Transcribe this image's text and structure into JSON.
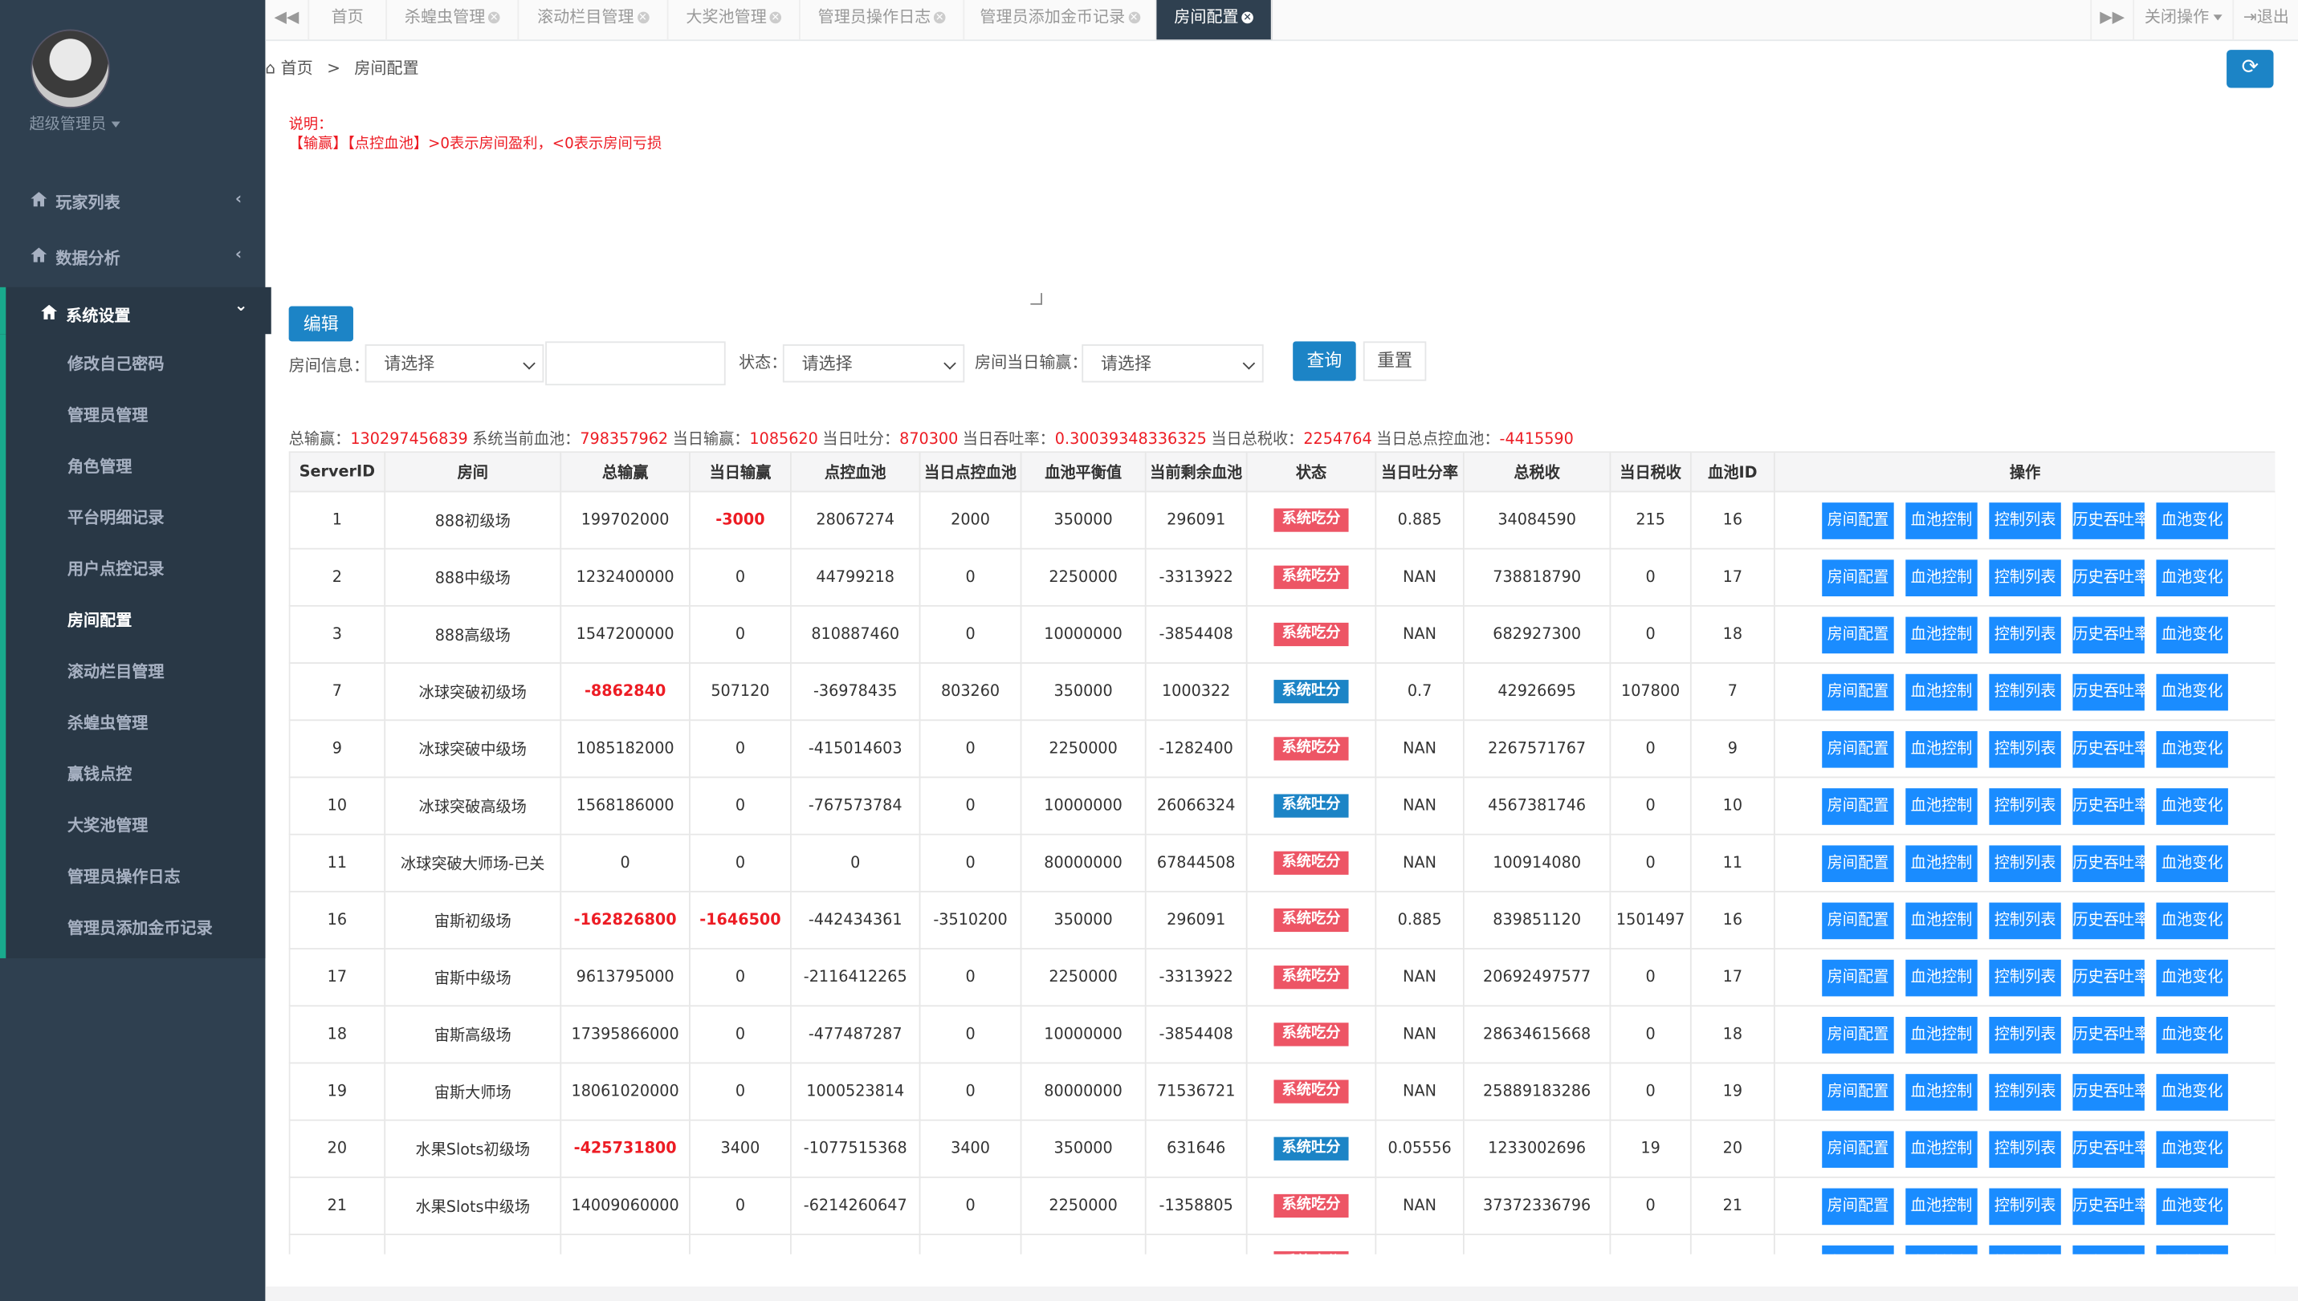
{
  "sidebar": {
    "user": "超级管理员",
    "menus": [
      {
        "label": "玩家列表",
        "chev": "‹"
      },
      {
        "label": "数据分析",
        "chev": "‹"
      },
      {
        "label": "系统设置",
        "chev": "⌄"
      }
    ],
    "subitems": [
      "修改自己密码",
      "管理员管理",
      "角色管理",
      "平台明细记录",
      "用户点控记录",
      "房间配置",
      "滚动栏目管理",
      "杀蝗虫管理",
      "赢钱点控",
      "大奖池管理",
      "管理员操作日志",
      "管理员添加金币记录"
    ]
  },
  "tabs": {
    "prev": "◀◀",
    "items": [
      "首页",
      "杀蝗虫管理",
      "滚动栏目管理",
      "大奖池管理",
      "管理员操作日志",
      "管理员添加金币记录",
      "房间配置"
    ],
    "next": "▶▶",
    "close_ops": "关闭操作",
    "logout": "退出"
  },
  "breadcrumb": {
    "home": "首页",
    "sep": ">",
    "current": "房间配置"
  },
  "note": {
    "title": "说明：",
    "text": "【输赢】【点控血池】>0表示房间盈利，<0表示房间亏损"
  },
  "buttons": {
    "edit": "编辑",
    "query": "查询",
    "reset": "重置"
  },
  "filters": {
    "room_info_label": "房间信息：",
    "room_info_placeholder": "请选择",
    "status_label": "状态：",
    "status_placeholder": "请选择",
    "daily_label": "房间当日输赢：",
    "daily_placeholder": "请选择"
  },
  "summary": [
    {
      "label": "总输赢：",
      "value": "130297456839"
    },
    {
      "label": "系统当前血池：",
      "value": "798357962"
    },
    {
      "label": "当日输赢：",
      "value": "1085620"
    },
    {
      "label": "当日吐分：",
      "value": "870300"
    },
    {
      "label": "当日吞吐率：",
      "value": "0.30039348336325"
    },
    {
      "label": "当日总税收：",
      "value": "2254764"
    },
    {
      "label": "当日总点控血池：",
      "value": "-4415590"
    }
  ],
  "table": {
    "headers": [
      "ServerID",
      "房间",
      "总输赢",
      "当日输赢",
      "点控血池",
      "当日点控血池",
      "血池平衡值",
      "当前剩余血池",
      "状态",
      "当日吐分率",
      "总税收",
      "当日税收",
      "血池ID",
      "操作"
    ],
    "ops": [
      "房间配置",
      "血池控制",
      "控制列表",
      "历史吞吐率",
      "血池变化"
    ],
    "rows": [
      [
        "1",
        "888初级场",
        "199702000",
        "-3000",
        "28067274",
        "2000",
        "350000",
        "296091",
        "系统吃分",
        "0.885",
        "34084590",
        "215",
        "16"
      ],
      [
        "2",
        "888中级场",
        "1232400000",
        "0",
        "44799218",
        "0",
        "2250000",
        "-3313922",
        "系统吃分",
        "NAN",
        "738818790",
        "0",
        "17"
      ],
      [
        "3",
        "888高级场",
        "1547200000",
        "0",
        "810887460",
        "0",
        "10000000",
        "-3854408",
        "系统吃分",
        "NAN",
        "682927300",
        "0",
        "18"
      ],
      [
        "7",
        "冰球突破初级场",
        "-8862840",
        "507120",
        "-36978435",
        "803260",
        "350000",
        "1000322",
        "系统吐分",
        "0.7",
        "42926695",
        "107800",
        "7"
      ],
      [
        "9",
        "冰球突破中级场",
        "1085182000",
        "0",
        "-415014603",
        "0",
        "2250000",
        "-1282400",
        "系统吃分",
        "NAN",
        "2267571767",
        "0",
        "9"
      ],
      [
        "10",
        "冰球突破高级场",
        "1568186000",
        "0",
        "-767573784",
        "0",
        "10000000",
        "26066324",
        "系统吐分",
        "NAN",
        "4567381746",
        "0",
        "10"
      ],
      [
        "11",
        "冰球突破大师场-已关",
        "0",
        "0",
        "0",
        "0",
        "80000000",
        "67844508",
        "系统吃分",
        "NAN",
        "100914080",
        "0",
        "11"
      ],
      [
        "16",
        "宙斯初级场",
        "-162826800",
        "-1646500",
        "-442434361",
        "-3510200",
        "350000",
        "296091",
        "系统吃分",
        "0.885",
        "839851120",
        "1501497",
        "16"
      ],
      [
        "17",
        "宙斯中级场",
        "9613795000",
        "0",
        "-2116412265",
        "0",
        "2250000",
        "-3313922",
        "系统吃分",
        "NAN",
        "20692497577",
        "0",
        "17"
      ],
      [
        "18",
        "宙斯高级场",
        "17395866000",
        "0",
        "-477487287",
        "0",
        "10000000",
        "-3854408",
        "系统吃分",
        "NAN",
        "28634615668",
        "0",
        "18"
      ],
      [
        "19",
        "宙斯大师场",
        "18061020000",
        "0",
        "1000523814",
        "0",
        "80000000",
        "71536721",
        "系统吃分",
        "NAN",
        "25889183286",
        "0",
        "19"
      ],
      [
        "20",
        "水果Slots初级场",
        "-425731800",
        "3400",
        "-1077515368",
        "3400",
        "350000",
        "631646",
        "系统吐分",
        "0.05556",
        "1233002696",
        "19",
        "20"
      ],
      [
        "21",
        "水果Slots中级场",
        "14009060000",
        "0",
        "-6214260647",
        "0",
        "2250000",
        "-1358805",
        "系统吃分",
        "NAN",
        "37372336796",
        "0",
        "21"
      ],
      [
        "",
        "",
        "",
        "",
        "",
        "",
        "",
        "",
        "系统吃分",
        "",
        "",
        "",
        ""
      ]
    ]
  }
}
